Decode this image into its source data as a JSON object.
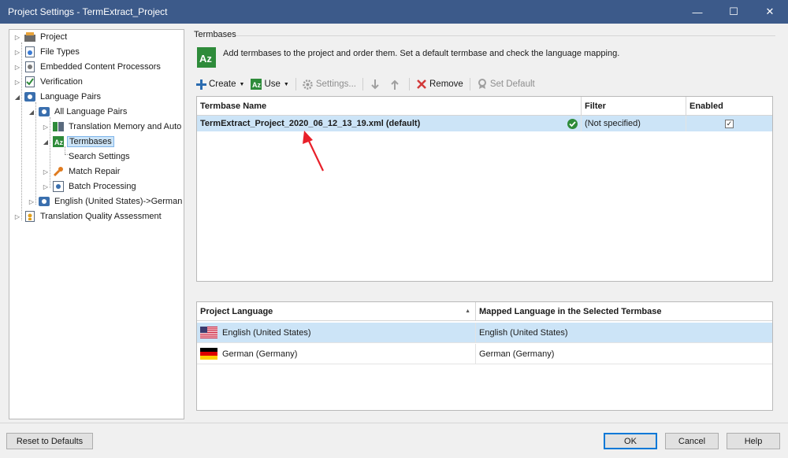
{
  "window": {
    "title": "Project Settings - TermExtract_Project",
    "minimize": "—",
    "maximize": "☐",
    "close": "✕"
  },
  "tree": {
    "items": [
      {
        "label": "Project",
        "icon": "project-icon"
      },
      {
        "label": "File Types",
        "icon": "file-types-icon"
      },
      {
        "label": "Embedded Content Processors",
        "icon": "embedded-content-icon"
      },
      {
        "label": "Verification",
        "icon": "verification-icon"
      },
      {
        "label": "Language Pairs",
        "icon": "language-pairs-icon"
      },
      {
        "label": "All Language Pairs",
        "icon": "language-pairs-icon"
      },
      {
        "label": "Translation Memory and Auto",
        "icon": "translation-memory-icon"
      },
      {
        "label": "Termbases",
        "icon": "termbase-icon"
      },
      {
        "label": "Search Settings",
        "icon": ""
      },
      {
        "label": "Match Repair",
        "icon": "wrench-icon"
      },
      {
        "label": "Batch Processing",
        "icon": "batch-icon"
      },
      {
        "label": "English (United States)->German (",
        "icon": "language-pairs-icon"
      },
      {
        "label": "Translation Quality Assessment",
        "icon": "quality-assessment-icon"
      }
    ]
  },
  "section": {
    "label": "Termbases",
    "description": "Add termbases to the project and order them. Set a default termbase and check the language mapping."
  },
  "toolbar": {
    "create": "Create",
    "use": "Use",
    "settings": "Settings...",
    "remove": "Remove",
    "set_default": "Set Default"
  },
  "termbases": {
    "columns": [
      "Termbase Name",
      "Filter",
      "Enabled"
    ],
    "rows": [
      {
        "name": "TermExtract_Project_2020_06_12_13_19.xml (default)",
        "filter": "(Not specified)",
        "enabled": true
      }
    ]
  },
  "mapping": {
    "columns": [
      "Project Language",
      "Mapped Language in the Selected Termbase"
    ],
    "rows": [
      {
        "language": "English (United States)",
        "mapped": "English (United States)",
        "flag": "us-flag"
      },
      {
        "language": "German (Germany)",
        "mapped": "German (Germany)",
        "flag": "de-flag"
      }
    ]
  },
  "buttons": {
    "reset": "Reset to Defaults",
    "ok": "OK",
    "cancel": "Cancel",
    "help": "Help"
  },
  "colors": {
    "titlebar": "#3c5a8a",
    "selection": "#cce4f7",
    "accent": "#0078d7",
    "annotation_arrow": "#e8202a"
  }
}
